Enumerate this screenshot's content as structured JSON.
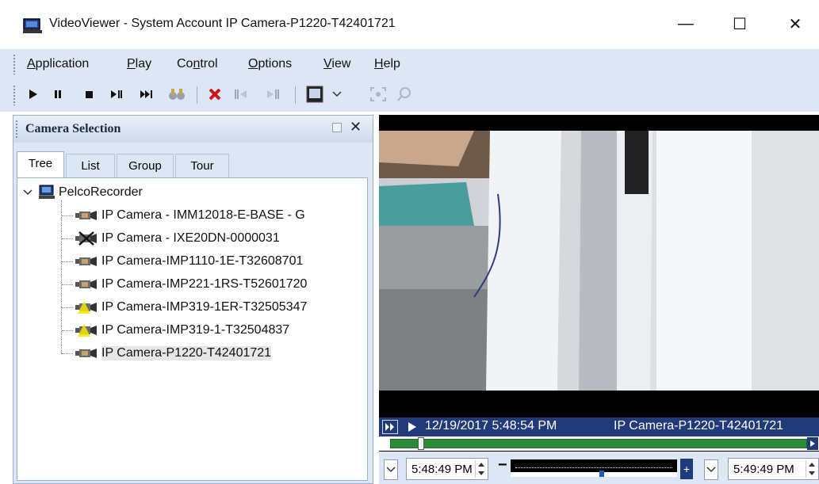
{
  "window": {
    "title": "VideoViewer - System Account IP Camera-P1220-T42401721",
    "minimize_glyph": "—",
    "maximize_glyph": "☐",
    "close_glyph": "✕"
  },
  "menu": {
    "items": [
      {
        "accel": "A",
        "rest": "pplication"
      },
      {
        "accel": "P",
        "rest": "lay"
      },
      {
        "pre": "Co",
        "accel": "n",
        "rest": "trol"
      },
      {
        "accel": "O",
        "rest": "ptions"
      },
      {
        "accel": "V",
        "rest": "iew"
      },
      {
        "accel": "H",
        "rest": "elp"
      }
    ]
  },
  "toolbar": {
    "icons": [
      "play-icon",
      "pause-icon",
      "stop-icon",
      "step-forward-icon",
      "skip-forward-icon",
      "binoculars-icon",
      "delete-icon",
      "prev-marker-icon",
      "next-marker-icon",
      "layout-icon",
      "dropdown-icon",
      "zoom-fit-icon",
      "search-icon"
    ]
  },
  "panel": {
    "title": "Camera Selection",
    "tabs": [
      "Tree",
      "List",
      "Group",
      "Tour"
    ],
    "active_tab": "Tree",
    "root": "PelcoRecorder",
    "cameras": [
      {
        "label": "IP Camera - IMM12018-E-BASE - G",
        "status": "normal"
      },
      {
        "label": "IP Camera - IXE20DN-0000031",
        "status": "offline"
      },
      {
        "label": "IP Camera-IMP1110-1E-T32608701",
        "status": "normal"
      },
      {
        "label": "IP Camera-IMP221-1RS-T52601720",
        "status": "normal"
      },
      {
        "label": "IP Camera-IMP319-1ER-T32505347",
        "status": "warning"
      },
      {
        "label": "IP Camera-IMP319-1-T32504837",
        "status": "warning"
      },
      {
        "label": "IP Camera-P1220-T42401721",
        "status": "selected"
      }
    ]
  },
  "video": {
    "timestamp": "12/19/2017 5:48:54 PM",
    "camera_name": "IP Camera-P1220-T42401721",
    "start_time": "5:48:49 PM",
    "end_time": "5:49:49 PM",
    "slider_position": 0.55
  },
  "colors": {
    "chrome": "#dce6f4",
    "status_bar": "#203a7a",
    "progress_green": "#2e8b3a"
  }
}
